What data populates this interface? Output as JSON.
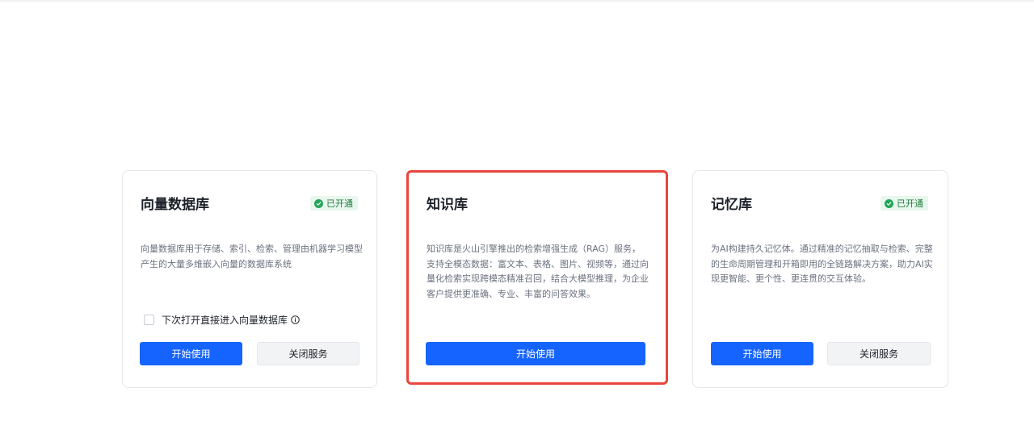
{
  "cards": [
    {
      "title": "向量数据库",
      "badge": "已开通",
      "description": "向量数据库用于存储、索引、检索、管理由机器学习模型产生的大量多维嵌入向量的数据库系统",
      "checkbox_label": "下次打开直接进入向量数据库",
      "primary_button": "开始使用",
      "secondary_button": "关闭服务"
    },
    {
      "title": "知识库",
      "description": "知识库是火山引擎推出的检索增强生成（RAG）服务，支持全模态数据：富文本、表格、图片、视频等，通过向量化检索实现跨模态精准召回，结合大模型推理，为企业客户提供更准确、专业、丰富的问答效果。",
      "primary_button": "开始使用",
      "highlight_color": "#e8453c"
    },
    {
      "title": "记忆库",
      "badge": "已开通",
      "description": "为AI构建持久记忆体。通过精准的记忆抽取与检索、完整的生命周期管理和开箱即用的全链路解决方案，助力AI实现更智能、更个性、更连贯的交互体验。",
      "primary_button": "开始使用",
      "secondary_button": "关闭服务"
    }
  ],
  "colors": {
    "primary": "#1664ff",
    "badge_bg": "#e8f7ed",
    "badge_text": "#1f7a3d",
    "highlight": "#e8453c"
  },
  "icons": {
    "badge": "check-circle-icon",
    "info": "info-circle-icon"
  }
}
